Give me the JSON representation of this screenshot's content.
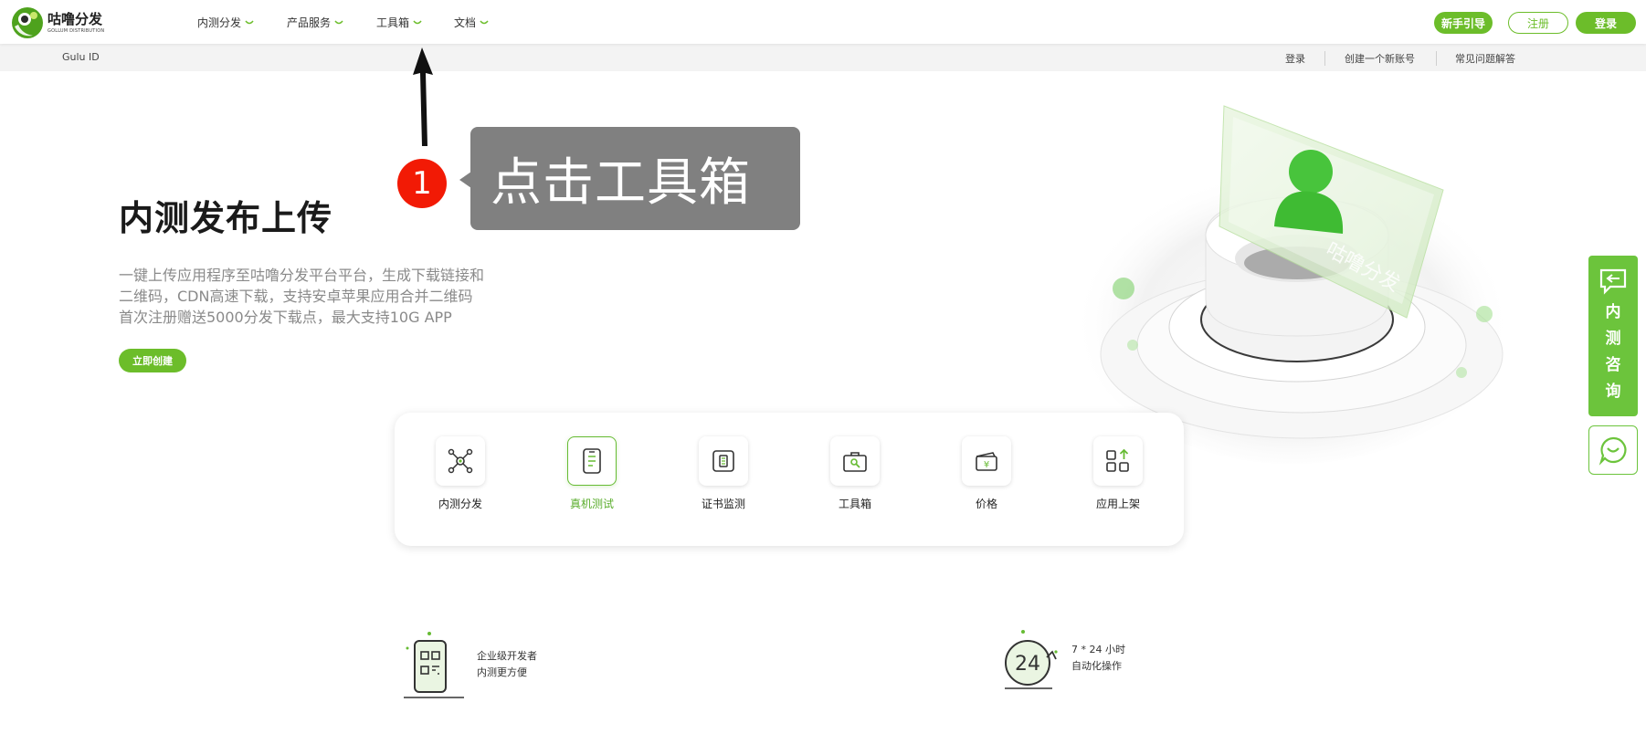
{
  "nav": {
    "logo_title": "咕噜分发",
    "logo_subtitle": "GOLLUM DISTRIBUTION",
    "items": [
      {
        "label": "内测分发"
      },
      {
        "label": "产品服务"
      },
      {
        "label": "工具箱"
      },
      {
        "label": "文档"
      }
    ],
    "guide_button": "新手引导",
    "register_button": "注册",
    "login_button": "登录"
  },
  "subbar": {
    "left_text": "Gulu ID",
    "links": [
      "登录",
      "创建一个新账号",
      "常见问题解答"
    ]
  },
  "hero": {
    "title": "内测发布上传",
    "desc_lines": [
      "一键上传应用程序至咕噜分发平台平台，生成下载链接和",
      "二维码，CDN高速下载，支持安卓苹果应用合并二维码",
      "首次注册赠送5000分发下载点，最大支持10G APP"
    ],
    "create_button": "立即创建",
    "illustration_watermark": "咕噜分发"
  },
  "annotation": {
    "step": "1",
    "text": "点击工具箱"
  },
  "features": [
    {
      "label": "内测分发",
      "icon": "network-icon",
      "active": false
    },
    {
      "label": "真机测试",
      "icon": "phone-test-icon",
      "active": true
    },
    {
      "label": "证书监测",
      "icon": "certificate-icon",
      "active": false
    },
    {
      "label": "工具箱",
      "icon": "toolbox-icon",
      "active": false
    },
    {
      "label": "价格",
      "icon": "price-icon",
      "active": false
    },
    {
      "label": "应用上架",
      "icon": "app-upload-icon",
      "active": false
    }
  ],
  "bottom_features": [
    {
      "line1": "企业级开发者",
      "line2": "内测更方便",
      "icon": "qr-phone-icon"
    },
    {
      "line1": "7 * 24 小时",
      "line2": "自动化操作",
      "icon": "clock-24-icon"
    }
  ],
  "float": {
    "consult_label": "内测咨询",
    "chat_icon": "chat-icon"
  },
  "colors": {
    "accent": "#6cbd2a",
    "accent_light": "#66bb33",
    "badge_red": "#f21a05",
    "callout_gray": "#808080"
  }
}
